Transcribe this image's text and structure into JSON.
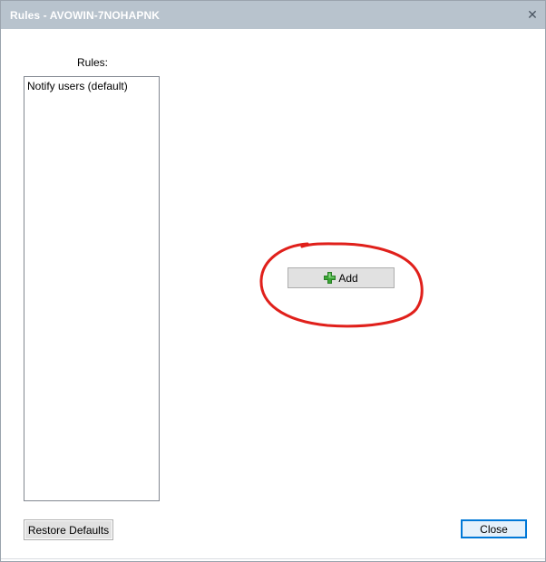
{
  "window": {
    "title": "Rules - AVOWIN-7NOHAPNK",
    "close_glyph": "✕"
  },
  "rules": {
    "label": "Rules:",
    "items": [
      "Notify users (default)"
    ]
  },
  "buttons": {
    "add_label": "Add",
    "restore_label": "Restore Defaults",
    "close_label": "Close"
  },
  "icons": {
    "add": "plus-icon",
    "window_close": "close-icon"
  },
  "colors": {
    "titlebar": "#b8c3cd",
    "annotation": "#e0201b",
    "plus_green": "#3aa635",
    "focus_border": "#0078d7"
  }
}
